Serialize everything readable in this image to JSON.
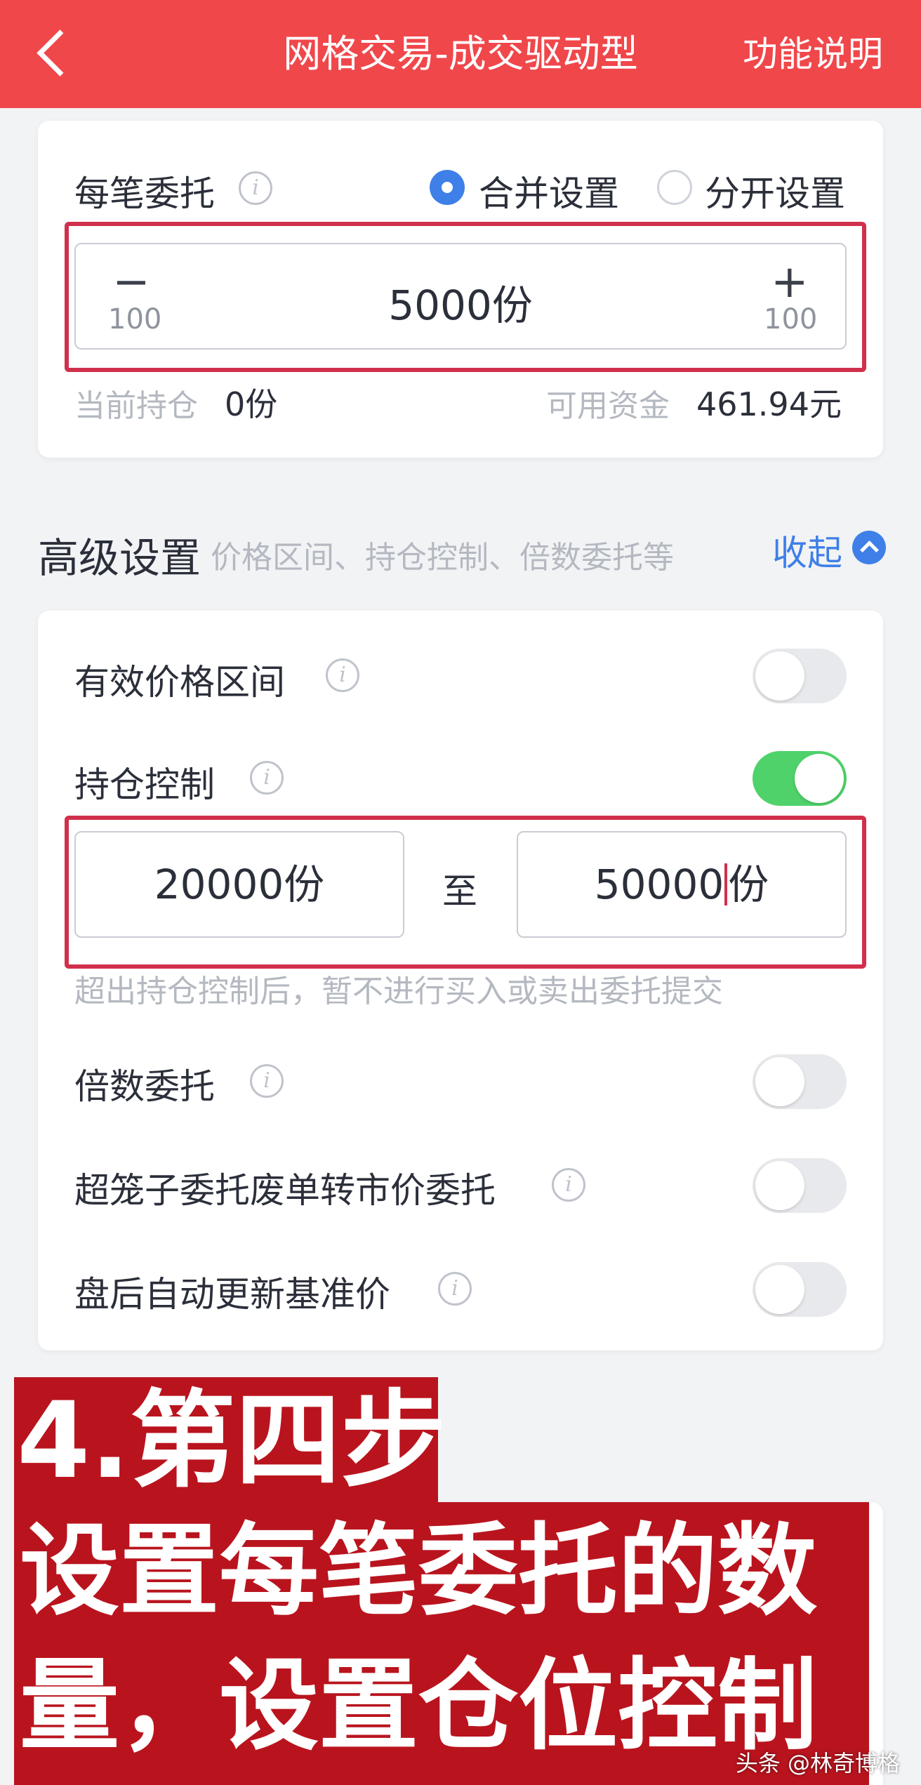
{
  "header": {
    "back_icon": "chevron-left-icon",
    "title": "网格交易-成交驱动型",
    "help": "功能说明"
  },
  "order": {
    "label": "每笔委托",
    "info_icon": "info-icon",
    "mode_merge": "合并设置",
    "mode_split": "分开设置",
    "selected_mode": "合并设置",
    "minus_symbol": "−",
    "minus_step": "100",
    "plus_symbol": "+",
    "plus_step": "100",
    "value": "5000份",
    "position_label": "当前持仓",
    "position_value": "0份",
    "funds_label": "可用资金",
    "funds_value": "461.94元"
  },
  "advanced": {
    "title": "高级设置",
    "subtitle": "价格区间、持仓控制、倍数委托等",
    "collapse": "收起",
    "items": [
      {
        "label": "有效价格区间",
        "enabled": false
      },
      {
        "label": "持仓控制",
        "enabled": true
      },
      {
        "label": "倍数委托",
        "enabled": false
      },
      {
        "label": "超笼子委托废单转市价委托",
        "enabled": false
      },
      {
        "label": "盘后自动更新基准价",
        "enabled": false
      }
    ],
    "range_from": "20000份",
    "range_to_label": "至",
    "range_to_num": "50000",
    "range_to_unit": "份",
    "range_hint": "超出持仓控制后，暂不进行买入或卖出委托提交"
  },
  "overlay": {
    "line1": "4.第四步",
    "line2": "设置每笔委托的数",
    "line3": "量，设置仓位控制"
  },
  "watermark": "头条 @林奇博格",
  "colors": {
    "header": "#f0474b",
    "accent": "#3f7fe8",
    "toggle_on": "#4fd26a",
    "highlight": "#d0304b",
    "overlay": "#b9141e"
  }
}
